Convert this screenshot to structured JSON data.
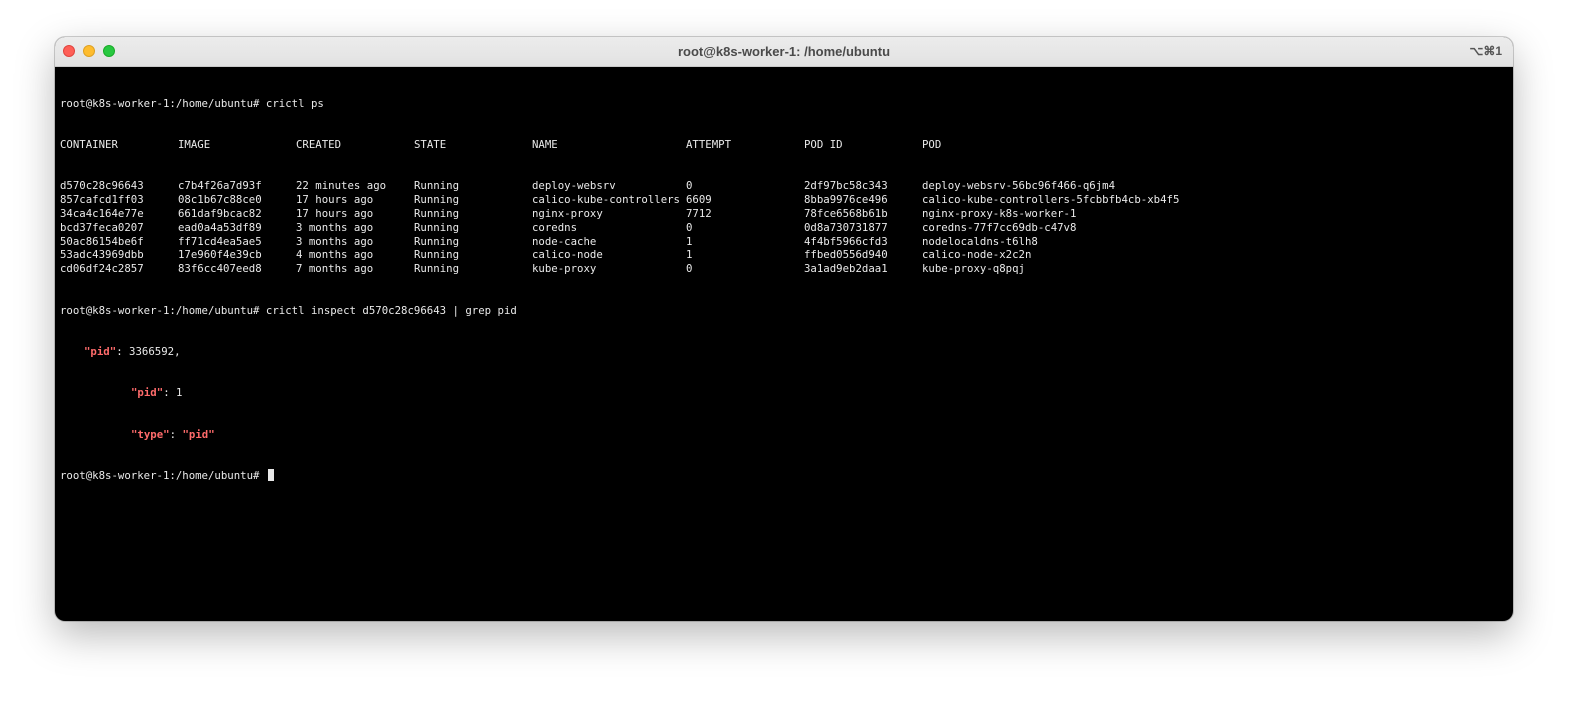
{
  "window": {
    "title": "root@k8s-worker-1: /home/ubuntu",
    "shortcut": "⌥⌘1"
  },
  "terminal": {
    "prompt": "root@k8s-worker-1:/home/ubuntu# ",
    "command1": "crictl ps",
    "headers": [
      "CONTAINER",
      "IMAGE",
      "CREATED",
      "STATE",
      "NAME",
      "ATTEMPT",
      "POD ID",
      "POD"
    ],
    "rows": [
      [
        "d570c28c96643",
        "c7b4f26a7d93f",
        "22 minutes ago",
        "Running",
        "deploy-websrv",
        "0",
        "2df97bc58c343",
        "deploy-websrv-56bc96f466-q6jm4"
      ],
      [
        "857cafcd1ff03",
        "08c1b67c88ce0",
        "17 hours ago",
        "Running",
        "calico-kube-controllers",
        "6609",
        "8bba9976ce496",
        "calico-kube-controllers-5fcbbfb4cb-xb4f5"
      ],
      [
        "34ca4c164e77e",
        "661daf9bcac82",
        "17 hours ago",
        "Running",
        "nginx-proxy",
        "7712",
        "78fce6568b61b",
        "nginx-proxy-k8s-worker-1"
      ],
      [
        "bcd37feca0207",
        "ead0a4a53df89",
        "3 months ago",
        "Running",
        "coredns",
        "0",
        "0d8a730731877",
        "coredns-77f7cc69db-c47v8"
      ],
      [
        "50ac86154be6f",
        "ff71cd4ea5ae5",
        "3 months ago",
        "Running",
        "node-cache",
        "1",
        "4f4bf5966cfd3",
        "nodelocaldns-t6lh8"
      ],
      [
        "53adc43969dbb",
        "17e960f4e39cb",
        "4 months ago",
        "Running",
        "calico-node",
        "1",
        "ffbed0556d940",
        "calico-node-x2c2n"
      ],
      [
        "cd06df24c2857",
        "83f6cc407eed8",
        "7 months ago",
        "Running",
        "kube-proxy",
        "0",
        "3a1ad9eb2daa1",
        "kube-proxy-q8pqj"
      ]
    ],
    "command2": "crictl inspect d570c28c96643 | grep pid",
    "json_lines": {
      "l1_key": "\"pid\"",
      "l1_rest": ": 3366592,",
      "l2_key": "\"pid\"",
      "l2_rest": ": 1",
      "l3_key": "\"type\"",
      "l3_mid": ": ",
      "l3_val": "\"pid\""
    }
  }
}
